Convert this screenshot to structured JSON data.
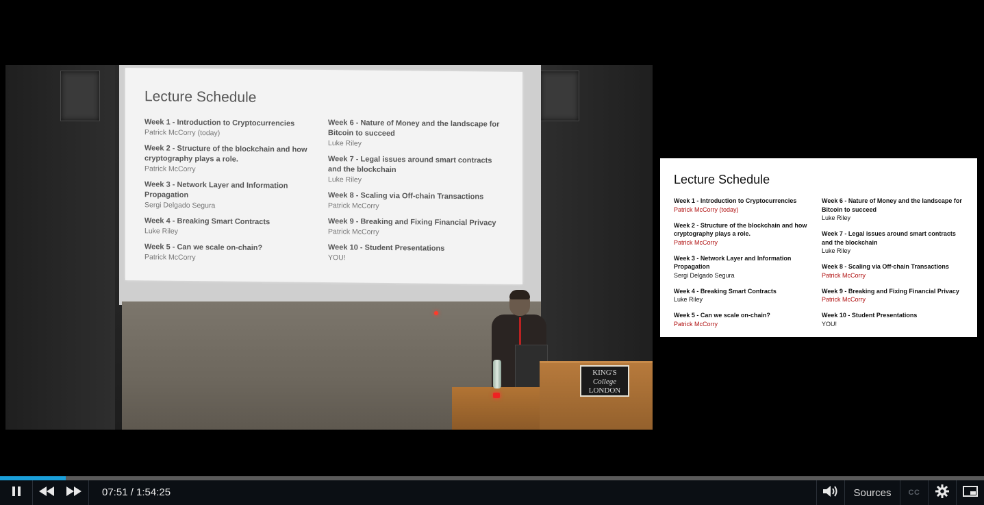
{
  "slide": {
    "title": "Lecture Schedule",
    "accent_color": "#b01010",
    "left": [
      {
        "week": "Week 1 - Introduction to Cryptocurrencies",
        "presenter": "Patrick McCorry (today)",
        "highlight": true
      },
      {
        "week": "Week 2 - Structure of the blockchain and how cryptography plays a role.",
        "presenter": "Patrick McCorry",
        "highlight": true
      },
      {
        "week": "Week 3 - Network Layer and Information Propagation",
        "presenter": "Sergi Delgado Segura",
        "highlight": false
      },
      {
        "week": "Week 4 - Breaking Smart Contracts",
        "presenter": "Luke Riley",
        "highlight": false
      },
      {
        "week": "Week 5 - Can we scale on-chain?",
        "presenter": "Patrick McCorry",
        "highlight": true
      }
    ],
    "right": [
      {
        "week": "Week 6 - Nature of Money and the landscape for Bitcoin to succeed",
        "presenter": "Luke Riley",
        "highlight": false
      },
      {
        "week": "Week 7 - Legal issues around smart contracts and the blockchain",
        "presenter": "Luke Riley",
        "highlight": false
      },
      {
        "week": "Week 8 - Scaling via Off-chain Transactions",
        "presenter": "Patrick McCorry",
        "highlight": true
      },
      {
        "week": "Week 9 - Breaking and Fixing Financial Privacy",
        "presenter": "Patrick McCorry",
        "highlight": true
      },
      {
        "week": "Week 10 - Student Presentations",
        "presenter": "YOU!",
        "highlight": false
      }
    ]
  },
  "podium_logo": [
    "KING'S",
    "College",
    "LONDON"
  ],
  "player": {
    "time_display": "07:51 / 1:54:25",
    "progress": 0.067,
    "accent_color": "#1a9fd9",
    "sources_label": "Sources",
    "cc_label": "CC",
    "icons": {
      "play_pause": "pause-icon",
      "rewind": "rewind-icon",
      "forward": "fast-forward-icon",
      "volume": "volume-icon",
      "settings": "gear-icon",
      "pip": "picture-in-picture-icon"
    }
  }
}
